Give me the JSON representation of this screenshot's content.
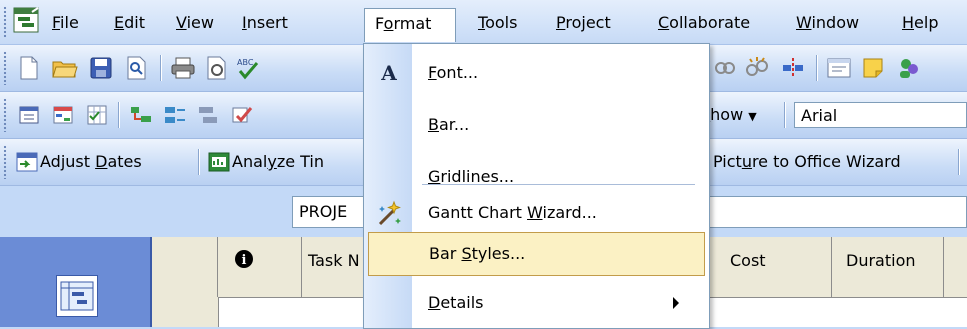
{
  "menubar": {
    "items": [
      "File",
      "Edit",
      "View",
      "Insert",
      "Format",
      "Tools",
      "Project",
      "Collaborate",
      "Window",
      "Help"
    ],
    "mnemonics": [
      "F",
      "E",
      "V",
      "I",
      "o",
      "T",
      "P",
      "C",
      "W",
      "H"
    ]
  },
  "format_menu": {
    "items": [
      {
        "label": "Font...",
        "mnemonic": "F",
        "icon": "font-a-icon"
      },
      {
        "label": "Bar...",
        "mnemonic": "B",
        "icon": ""
      },
      {
        "label": "Gridlines...",
        "mnemonic": "G",
        "icon": ""
      },
      {
        "label": "Gantt Chart Wizard...",
        "mnemonic": "W",
        "icon": "wizard-icon"
      },
      {
        "label": "Bar Styles...",
        "mnemonic": "S",
        "icon": "",
        "highlighted": true
      },
      {
        "label": "Details",
        "mnemonic": "D",
        "icon": "",
        "submenu": true
      }
    ]
  },
  "toolbar3": {
    "show_label": "Show",
    "font_value": "Arial"
  },
  "toolbar4": {
    "adjust_dates": "Adjust Dates",
    "analyze_timescaled": "Analyze Tin",
    "picture_wizard": "Picture to Office Wizard"
  },
  "entry_bar": {
    "value": "PROJE"
  },
  "table": {
    "columns": [
      "",
      "i",
      "Task N",
      "Cost",
      "Duration"
    ]
  },
  "colors": {
    "menu_highlight": "#fbf1c4",
    "toolbar": "#c3d9f7",
    "view_bar": "#6b8cd6"
  }
}
